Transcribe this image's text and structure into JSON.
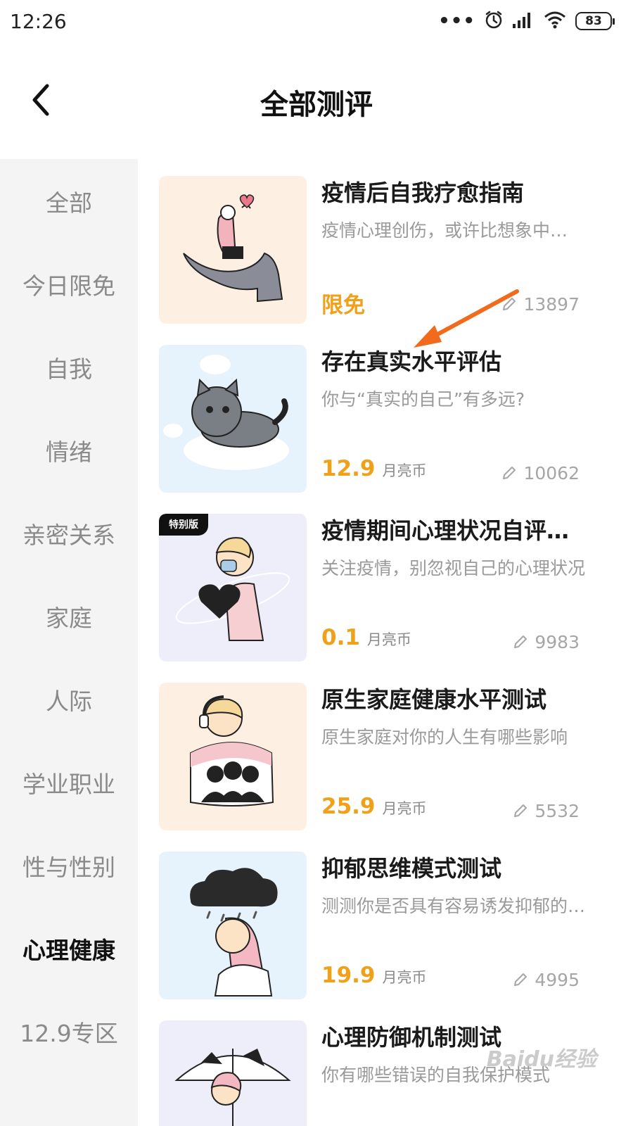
{
  "status_bar": {
    "time": "12:26",
    "battery": "83"
  },
  "header": {
    "title": "全部测评"
  },
  "sidebar": {
    "items": [
      {
        "label": "全部",
        "active": false
      },
      {
        "label": "今日限免",
        "active": false
      },
      {
        "label": "自我",
        "active": false
      },
      {
        "label": "情绪",
        "active": false
      },
      {
        "label": "亲密关系",
        "active": false
      },
      {
        "label": "家庭",
        "active": false
      },
      {
        "label": "人际",
        "active": false
      },
      {
        "label": "学业职业",
        "active": false
      },
      {
        "label": "性与性别",
        "active": false
      },
      {
        "label": "心理健康",
        "active": true
      },
      {
        "label": "12.9专区",
        "active": false
      }
    ]
  },
  "cards": [
    {
      "title": "疫情后自我疗愈指南",
      "desc": "疫情心理创伤，或许比想象中…",
      "price": "限免",
      "unit": "",
      "count": "13897",
      "badge": "",
      "thumb_bg": "#fdf0e3"
    },
    {
      "title": "存在真实水平评估",
      "desc": "你与“真实的自己”有多远?",
      "price": "12.9",
      "unit": "月亮币",
      "count": "10062",
      "badge": "",
      "thumb_bg": "#e6f2fc"
    },
    {
      "title": "疫情期间心理状况自评量表",
      "desc": "关注疫情，别忽视自己的心理状况",
      "price": "0.1",
      "unit": "月亮币",
      "count": "9983",
      "badge": "特别版",
      "thumb_bg": "#eeeefa"
    },
    {
      "title": "原生家庭健康水平测试",
      "desc": "原生家庭对你的人生有哪些影响",
      "price": "25.9",
      "unit": "月亮币",
      "count": "5532",
      "badge": "",
      "thumb_bg": "#fdf0e3"
    },
    {
      "title": "抑郁思维模式测试",
      "desc": "测测你是否具有容易诱发抑郁的思维",
      "price": "19.9",
      "unit": "月亮币",
      "count": "4995",
      "badge": "",
      "thumb_bg": "#e6f2fc"
    },
    {
      "title": "心理防御机制测试",
      "desc": "你有哪些错误的自我保护模式",
      "price": "",
      "unit": "",
      "count": "",
      "badge": "",
      "thumb_bg": "#eeeefa"
    }
  ],
  "watermark": "Baidu经验",
  "icons": {
    "back": "chevron-left-icon",
    "views": "pencil-icon"
  },
  "colors": {
    "price": "#f0a11a",
    "arrow": "#f26b1d",
    "sidebar_bg": "#f4f4f4"
  }
}
